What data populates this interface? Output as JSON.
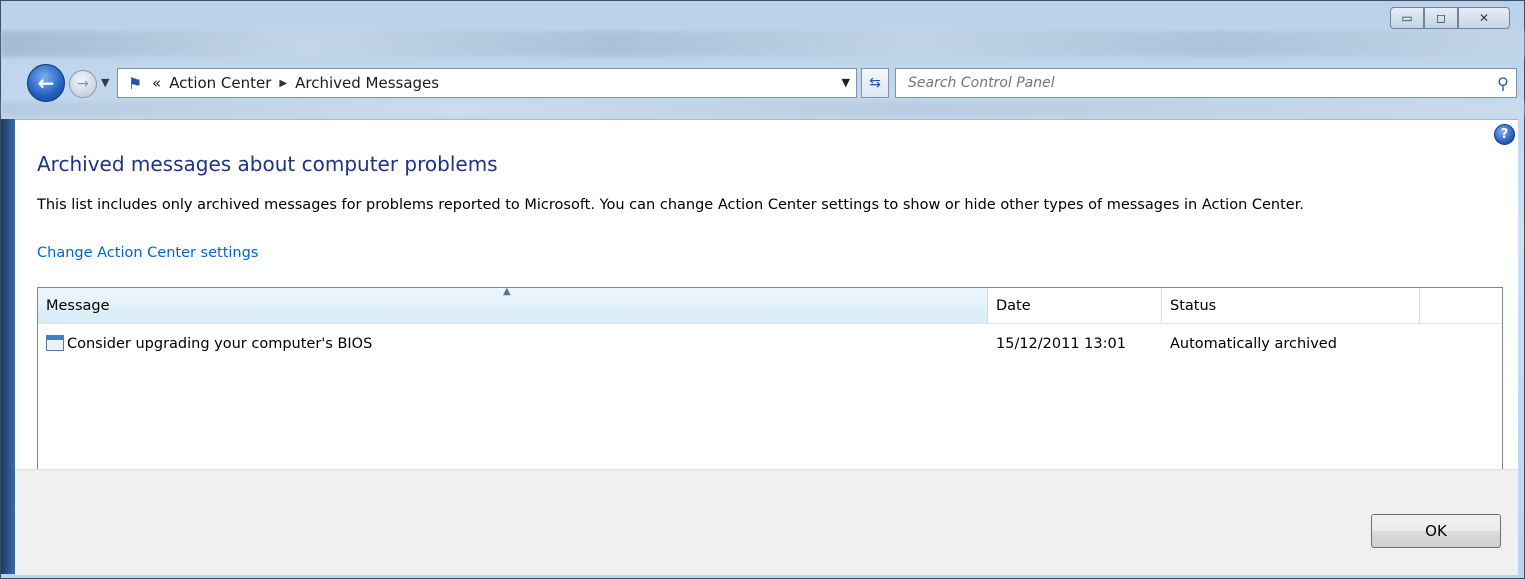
{
  "window": {
    "caption_buttons": [
      "minimize",
      "maximize",
      "close"
    ]
  },
  "nav": {
    "back_icon": "back-arrow-icon",
    "forward_icon": "forward-arrow-icon",
    "breadcrumb_prefix": "«",
    "breadcrumbs": [
      "Action Center",
      "Archived Messages"
    ],
    "search_placeholder": "Search Control Panel"
  },
  "main": {
    "title": "Archived messages about computer problems",
    "description": "This list includes only archived messages for problems reported to Microsoft. You can change Action Center settings to show or hide other types of messages in Action Center.",
    "settings_link": "Change Action Center settings",
    "table": {
      "columns": [
        "Message",
        "Date",
        "Status"
      ],
      "rows": [
        {
          "message": "Consider upgrading your computer's BIOS",
          "date": "15/12/2011 13:01",
          "status": "Automatically archived"
        }
      ]
    }
  },
  "footer": {
    "ok_label": "OK"
  },
  "colors": {
    "title": "#1e3287",
    "link": "#0066cc"
  }
}
